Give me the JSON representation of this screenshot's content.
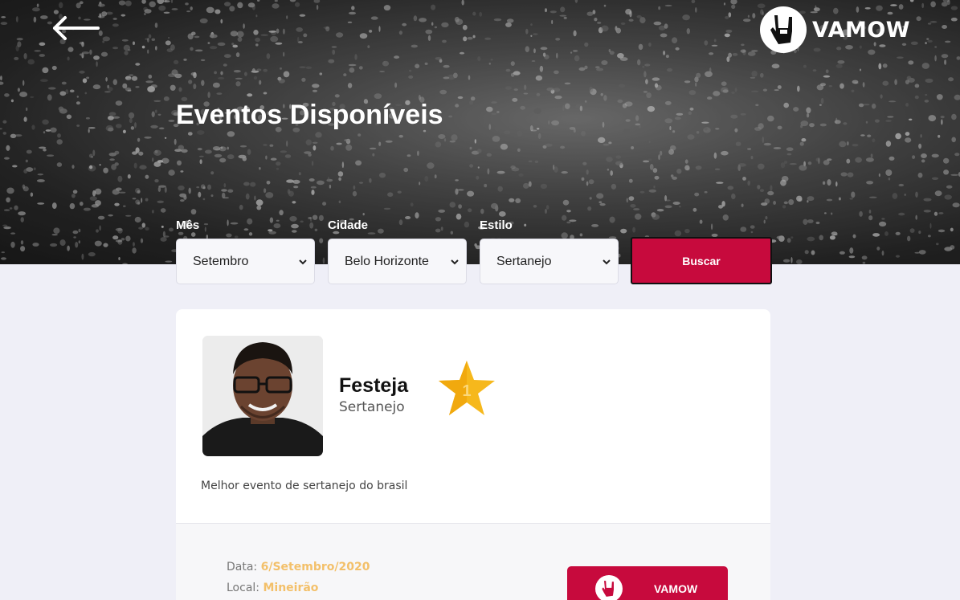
{
  "header": {
    "back_icon": "arrow-left-icon",
    "brand_icon": "rock-hand-icon",
    "brand_name": "VAMOW",
    "title": "Eventos Disponíveis"
  },
  "filters": {
    "month": {
      "label": "Mês",
      "value": "Setembro"
    },
    "city": {
      "label": "Cidade",
      "value": "Belo Horizonte"
    },
    "style": {
      "label": "Estilo",
      "value": "Sertanejo"
    },
    "search_label": "Buscar"
  },
  "event": {
    "name": "Festeja",
    "style": "Sertanejo",
    "rank": "1",
    "rank_icon": "star-icon",
    "description": "Melhor evento de sertanejo do brasil",
    "date_label": "Data:",
    "date_value": "6/Setembro/2020",
    "location_label": "Local:",
    "location_value": "Mineirão",
    "cta_label": "VAMOW"
  },
  "colors": {
    "accent": "#c70a3d",
    "highlight": "#f3c06a",
    "background": "#efeff7",
    "star": "#f6b81c"
  }
}
